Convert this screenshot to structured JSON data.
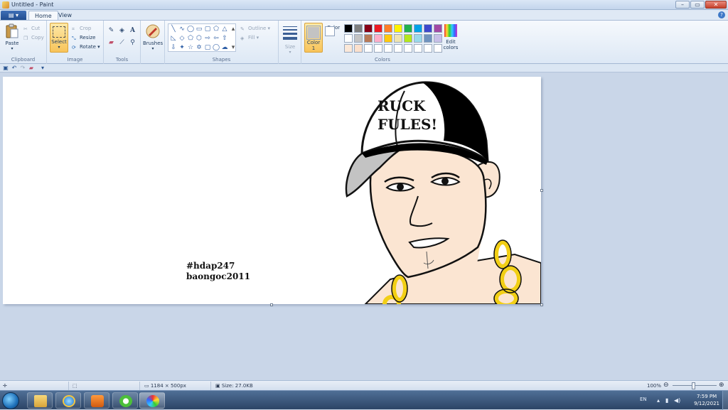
{
  "window": {
    "title": "Untitled - Paint"
  },
  "tabs": {
    "menu_label": "",
    "home": "Home",
    "view": "View"
  },
  "ribbon": {
    "clipboard": {
      "label": "Clipboard",
      "paste": "Paste",
      "cut": "Cut",
      "copy": "Copy"
    },
    "image": {
      "label": "Image",
      "select": "Select",
      "crop": "Crop",
      "resize": "Resize",
      "rotate": "Rotate"
    },
    "tools": {
      "label": "Tools"
    },
    "brushes": {
      "label": "Brushes"
    },
    "shapes": {
      "label": "Shapes",
      "outline": "Outline",
      "fill": "Fill"
    },
    "size": {
      "label": "Size"
    },
    "colors": {
      "label": "Colors",
      "color1": "Color",
      "color1_num": "1",
      "color2": "Color",
      "color2_num": "2",
      "edit": "Edit",
      "edit2": "colors",
      "color1_value": "#c3c3c3",
      "color2_value": "#ffffff",
      "palette_row1": [
        "#000000",
        "#7f7f7f",
        "#880015",
        "#ed1c24",
        "#ff7f27",
        "#fff200",
        "#22b14c",
        "#00a2e8",
        "#3f48cc",
        "#a349a4"
      ],
      "palette_row2": [
        "#ffffff",
        "#c3c3c3",
        "#b97a57",
        "#ffaec9",
        "#ffc90e",
        "#efe4b0",
        "#b5e61d",
        "#99d9ea",
        "#7092be",
        "#c8bfe7"
      ],
      "palette_row3": [
        "#fbe8d8",
        "#fbe0cc",
        "#ffffff",
        "#ffffff",
        "#ffffff",
        "#ffffff",
        "#ffffff",
        "#ffffff",
        "#ffffff",
        "#ffffff"
      ]
    }
  },
  "canvas": {
    "cap_text_line1": "RUCK",
    "cap_text_line2": "FULES!",
    "caption_line1": "#hdap247",
    "caption_line2": "baongoc2011"
  },
  "statusbar": {
    "dimensions": "1184 × 500px",
    "size": "Size: 27.0KB",
    "zoom": "100%"
  },
  "taskbar": {
    "lang": "EN",
    "time": "7:59 PM",
    "date": "9/12/2021"
  }
}
